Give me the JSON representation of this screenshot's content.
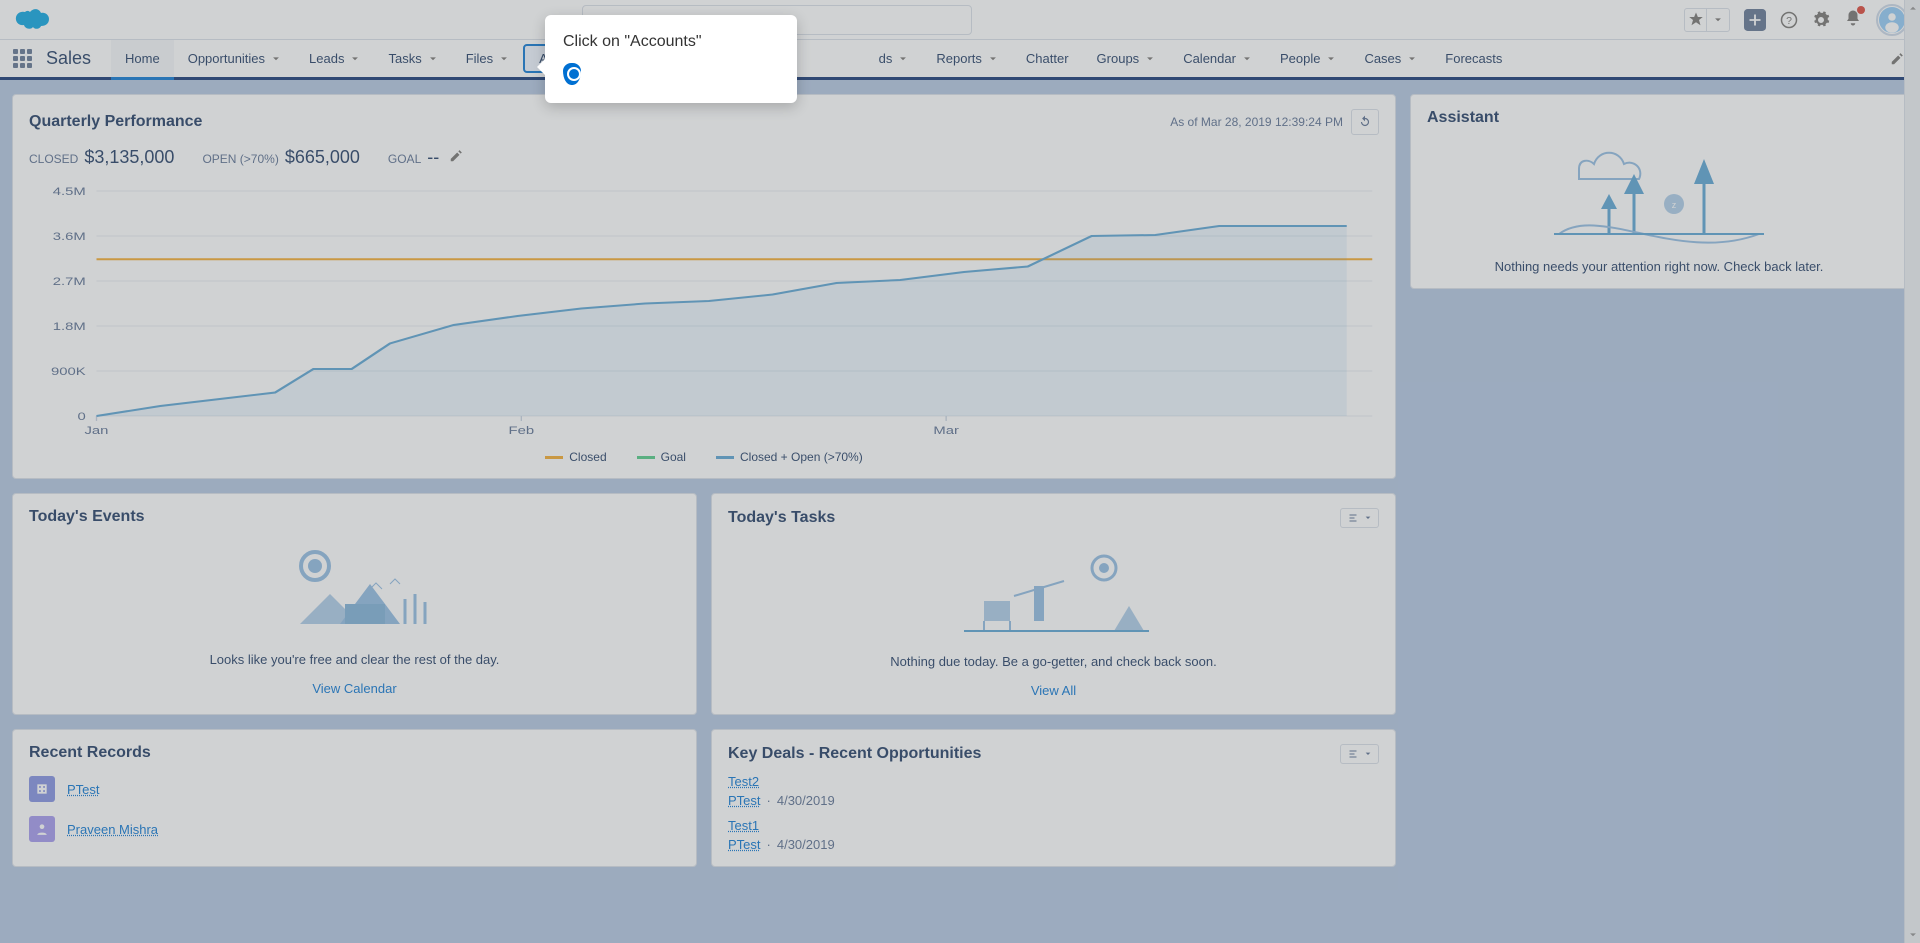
{
  "header": {
    "search_placeholder": "",
    "app_name": "Sales"
  },
  "nav": [
    {
      "label": "Home",
      "chevron": false,
      "active": true,
      "highlight": false
    },
    {
      "label": "Opportunities",
      "chevron": true,
      "active": false,
      "highlight": false
    },
    {
      "label": "Leads",
      "chevron": true,
      "active": false,
      "highlight": false
    },
    {
      "label": "Tasks",
      "chevron": true,
      "active": false,
      "highlight": false
    },
    {
      "label": "Files",
      "chevron": true,
      "active": false,
      "highlight": false
    },
    {
      "label": "Accounts",
      "chevron": true,
      "active": false,
      "highlight": true
    },
    {
      "label": "ds",
      "chevron": true,
      "active": false,
      "highlight": false,
      "hidden": true
    },
    {
      "label": "Reports",
      "chevron": true,
      "active": false,
      "highlight": false
    },
    {
      "label": "Chatter",
      "chevron": false,
      "active": false,
      "highlight": false
    },
    {
      "label": "Groups",
      "chevron": true,
      "active": false,
      "highlight": false
    },
    {
      "label": "Calendar",
      "chevron": true,
      "active": false,
      "highlight": false
    },
    {
      "label": "People",
      "chevron": true,
      "active": false,
      "highlight": false
    },
    {
      "label": "Cases",
      "chevron": true,
      "active": false,
      "highlight": false
    },
    {
      "label": "Forecasts",
      "chevron": false,
      "active": false,
      "highlight": false
    }
  ],
  "tooltip": {
    "text": "Click on \"Accounts\""
  },
  "quarterly": {
    "title": "Quarterly Performance",
    "as_of": "As of Mar 28, 2019 12:39:24 PM",
    "closed_label": "CLOSED",
    "closed_value": "$3,135,000",
    "open_label": "OPEN (>70%)",
    "open_value": "$665,000",
    "goal_label": "GOAL",
    "goal_value": "--",
    "legend": {
      "closed": "Closed",
      "goal": "Goal",
      "combined": "Closed + Open (>70%)"
    },
    "colors": {
      "closed": "#f5a623",
      "goal": "#4bca81",
      "combined": "#54a0d2"
    }
  },
  "chart_data": {
    "type": "line",
    "x_ticks": [
      "Jan",
      "Feb",
      "Mar"
    ],
    "y_ticks": [
      "0",
      "900K",
      "1.8M",
      "2.7M",
      "3.6M",
      "4.5M"
    ],
    "ylim": [
      0,
      4500000
    ],
    "series": [
      {
        "name": "Closed + Open (>70%)",
        "color": "#54a0d2",
        "points": [
          [
            0,
            0
          ],
          [
            5,
            200
          ],
          [
            10,
            350
          ],
          [
            14,
            470
          ],
          [
            17,
            940
          ],
          [
            20,
            940
          ],
          [
            23,
            1450
          ],
          [
            28,
            1820
          ],
          [
            33,
            2000
          ],
          [
            38,
            2150
          ],
          [
            43,
            2250
          ],
          [
            48,
            2300
          ],
          [
            53,
            2430
          ],
          [
            58,
            2660
          ],
          [
            63,
            2720
          ],
          [
            68,
            2880
          ],
          [
            73,
            2990
          ],
          [
            78,
            3600
          ],
          [
            83,
            3620
          ],
          [
            88,
            3800
          ],
          [
            93,
            3800
          ],
          [
            98,
            3800
          ]
        ]
      },
      {
        "name": "Closed",
        "color": "#f5a623",
        "flat": 3135000
      }
    ]
  },
  "events": {
    "title": "Today's Events",
    "empty": "Looks like you're free and clear the rest of the day.",
    "link": "View Calendar"
  },
  "tasks": {
    "title": "Today's Tasks",
    "empty": "Nothing due today. Be a go-getter, and check back soon.",
    "link": "View All"
  },
  "recent": {
    "title": "Recent Records",
    "rows": [
      {
        "icon": "account",
        "color": "#7f8de1",
        "label": "PTest"
      },
      {
        "icon": "contact",
        "color": "#a094ed",
        "label": "Praveen Mishra"
      }
    ]
  },
  "deals": {
    "title": "Key Deals - Recent Opportunities",
    "rows": [
      {
        "name": "Test2",
        "account": "PTest",
        "date": "4/30/2019"
      },
      {
        "name": "Test1",
        "account": "PTest",
        "date": "4/30/2019"
      }
    ]
  },
  "assistant": {
    "title": "Assistant",
    "empty": "Nothing needs your attention right now. Check back later."
  }
}
